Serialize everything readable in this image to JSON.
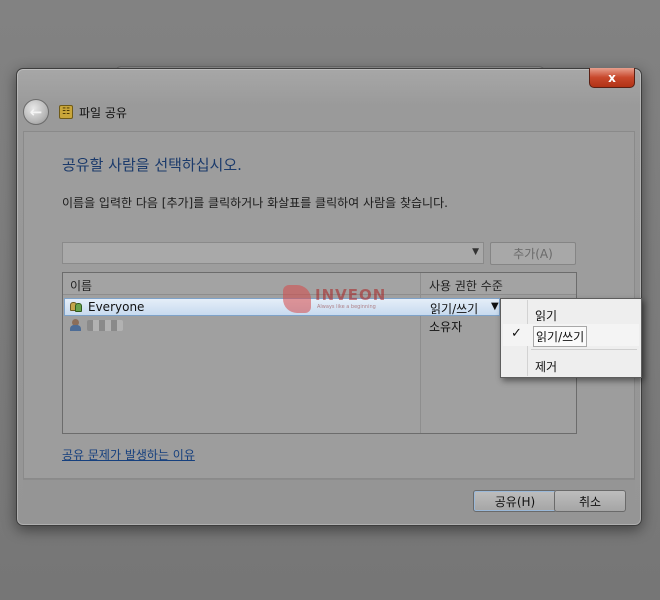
{
  "window": {
    "title": "파일 공유",
    "close_label": "x"
  },
  "main": {
    "heading": "공유할 사람을 선택하십시오.",
    "instruction": "이름을 입력한 다음 [추가]를 클릭하거나 화살표를 클릭하여 사람을 찾습니다.",
    "combo_value": "",
    "add_button": "추가(A)"
  },
  "list": {
    "columns": [
      "이름",
      "사용 권한 수준"
    ],
    "rows": [
      {
        "name": "Everyone",
        "permission": "읽기/쓰기",
        "icon": "users-icon",
        "selected": true
      },
      {
        "name": "",
        "permission": "소유자",
        "icon": "user-icon",
        "selected": false
      }
    ]
  },
  "context_menu": {
    "items": [
      {
        "label": "읽기",
        "checked": false
      },
      {
        "label": "읽기/쓰기",
        "checked": true
      },
      {
        "label": "제거",
        "checked": false
      }
    ],
    "check_glyph": "✓"
  },
  "help_link": "공유 문제가 발생하는 이유",
  "footer": {
    "share_button": "공유(H)",
    "cancel_button": "취소"
  },
  "watermark": {
    "text": "INVEON",
    "subtitle": "Always like a beginning"
  },
  "colors": {
    "heading": "#1b3a6b",
    "link": "#16407e",
    "close": "#c8482c",
    "selection": "#c7daef"
  }
}
